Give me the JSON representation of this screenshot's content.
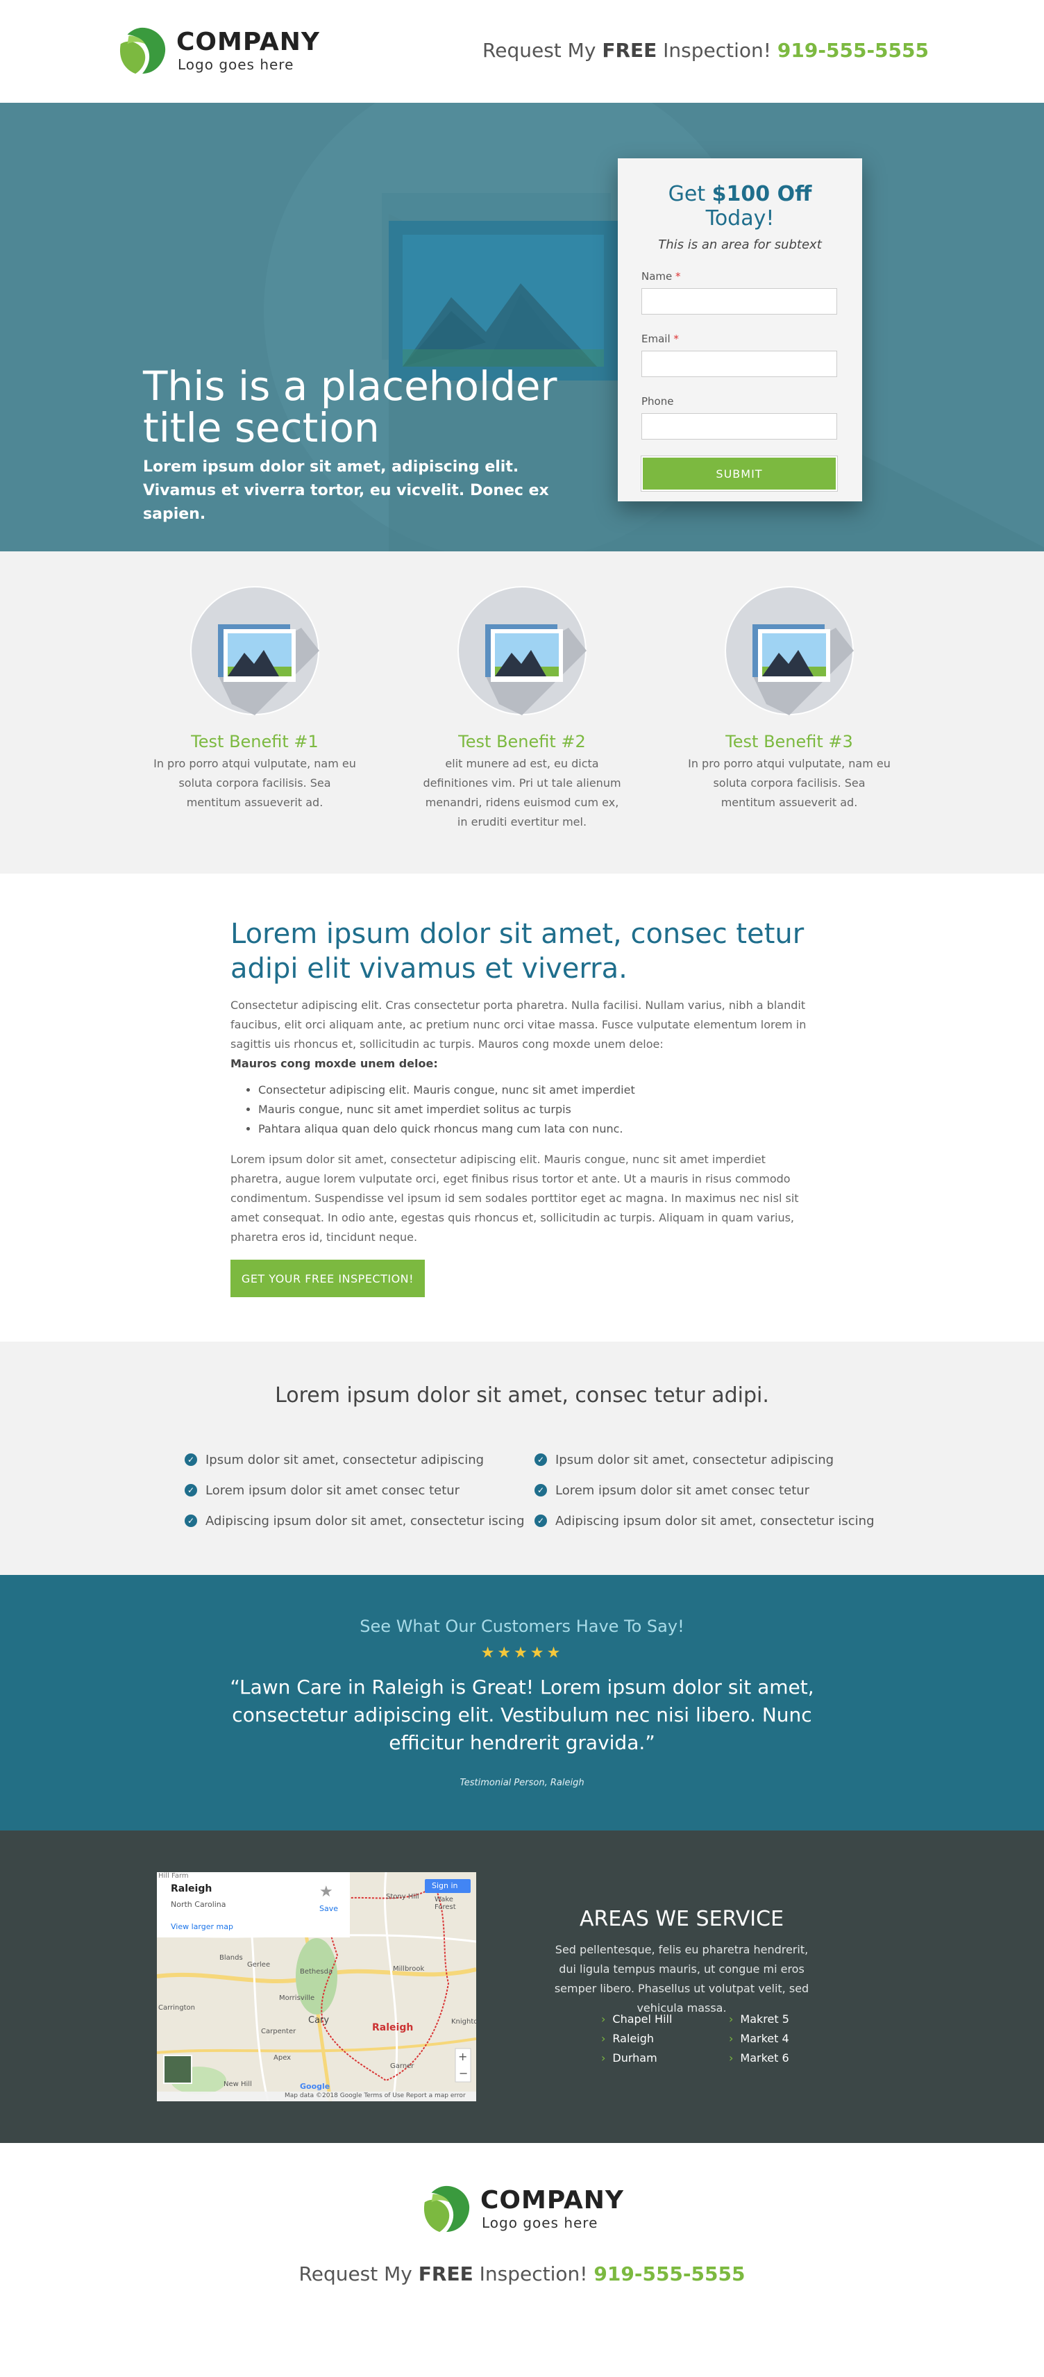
{
  "header": {
    "logo_name": "COMPANY",
    "logo_sub": "Logo goes here",
    "cta_prefix": "Request My ",
    "cta_bold": "FREE",
    "cta_suffix": " Inspection! ",
    "phone": "919-555-5555"
  },
  "hero": {
    "title": "This is a placeholder title section",
    "subtitle": "Lorem ipsum dolor sit amet, adipiscing elit. Vivamus et viverra tortor, eu vicvelit. Donec ex sapien.",
    "form": {
      "title_prefix": "Get ",
      "title_bold": "$100 Off",
      "title_suffix": " Today!",
      "subtext": "This is an area for subtext",
      "name_label": "Name",
      "email_label": "Email",
      "phone_label": "Phone",
      "required_mark": "*",
      "submit_label": "SUBMIT"
    }
  },
  "benefits": [
    {
      "title": "Test Benefit #1",
      "text": "In pro porro atqui vulputate, nam eu soluta corpora facilisis. Sea mentitum assueverit ad."
    },
    {
      "title": "Test Benefit #2",
      "text": "elit munere ad est, eu dicta definitiones vim. Pri ut tale alienum menandri, ridens euismod cum ex, in eruditi evertitur mel."
    },
    {
      "title": "Test Benefit #3",
      "text": "In pro porro atqui vulputate, nam eu soluta corpora facilisis. Sea mentitum assueverit ad."
    }
  ],
  "content": {
    "heading": "Lorem ipsum dolor sit amet, consec tetur adipi elit vivamus et viverra.",
    "paragraph1": "Consectetur adipiscing elit. Cras consectetur porta pharetra. Nulla facilisi. Nullam varius, nibh a blandit faucibus, elit orci aliquam ante, ac pretium nunc orci vitae massa. Fusce vulputate elementum lorem in sagittis uis rhoncus et, sollicitudin ac turpis. Mauros cong moxde unem deloe:",
    "bold_line": "Mauros cong moxde unem deloe:",
    "list": [
      "Consectetur adipiscing elit. Mauris congue, nunc sit amet imperdiet",
      "Mauris congue, nunc sit amet imperdiet solitus ac turpis",
      "Pahtara aliqua quan delo quick rhoncus mang cum lata con nunc."
    ],
    "paragraph2": "Lorem ipsum dolor sit amet, consectetur adipiscing elit. Mauris congue, nunc sit amet imperdiet pharetra, augue lorem vulputate orci, eget finibus risus tortor et ante. Ut a mauris in risus commodo condimentum. Suspendisse vel ipsum id sem sodales porttitor eget ac magna. In maximus nec nisl sit amet consequat. In odio ante, egestas quis rhoncus et, sollicitudin ac turpis. Aliquam in quam varius, pharetra eros id, tincidunt neque.",
    "cta_label": "GET YOUR FREE INSPECTION!"
  },
  "features": {
    "title": "Lorem ipsum dolor sit amet, consec tetur adipi.",
    "left": [
      "Ipsum dolor sit amet, consectetur adipiscing",
      "Lorem ipsum dolor sit amet consec tetur",
      "Adipiscing ipsum dolor sit amet, consectetur iscing"
    ],
    "right": [
      "Ipsum dolor sit amet, consectetur adipiscing",
      "Lorem ipsum dolor sit amet consec tetur",
      "Adipiscing ipsum dolor sit amet, consectetur iscing"
    ]
  },
  "testimonial": {
    "heading": "See What Our Customers Have To Say!",
    "stars": "★★★★★",
    "quote": "“Lawn Care in Raleigh is Great! Lorem ipsum dolor sit amet, consectetur adipiscing elit. Vestibulum nec nisi libero. Nunc efficitur hendrerit gravida.”",
    "author": "Testimonial Person,  Raleigh"
  },
  "areas": {
    "title": "AREAS WE SERVICE",
    "text": "Sed pellentesque, felis eu pharetra hendrerit, dui ligula tempus mauris, ut congue mi eros semper libero. Phasellus ut volutpat velit, sed vehicula massa.",
    "col1": [
      "Chapel Hill",
      "Raleigh",
      "Durham"
    ],
    "col2": [
      "Makret 5",
      "Market 4",
      "Market 6"
    ],
    "map": {
      "place": "Raleigh",
      "region": "North Carolina",
      "larger_link": "View larger map",
      "save": "Save",
      "signin": "Sign in",
      "zoom_in": "+",
      "zoom_out": "−",
      "city_label": "Raleigh",
      "footer_text": "Map data ©2018 Google   Terms of Use   Report a map error",
      "towns": [
        "Hill Farm",
        "Stony Hill",
        "Wake Forest",
        "Blands",
        "Gerlee",
        "Bethesda",
        "Morrisville",
        "Millbrook",
        "Cary",
        "Carpenter",
        "Apex",
        "Garner",
        "Knightdale",
        "New Hill",
        "Carrington"
      ],
      "google": "Google"
    }
  },
  "footer": {
    "logo_name": "COMPANY",
    "logo_sub": "Logo goes here",
    "cta_prefix": "Request My ",
    "cta_bold": "FREE",
    "cta_suffix": " Inspection! ",
    "phone": "919-555-5555"
  },
  "colors": {
    "brand_green": "#7cb940",
    "brand_teal": "#1f6e8c",
    "hero_bg": "#4f8795",
    "testimonial_bg": "#236f85",
    "areas_bg": "#3c4747"
  }
}
